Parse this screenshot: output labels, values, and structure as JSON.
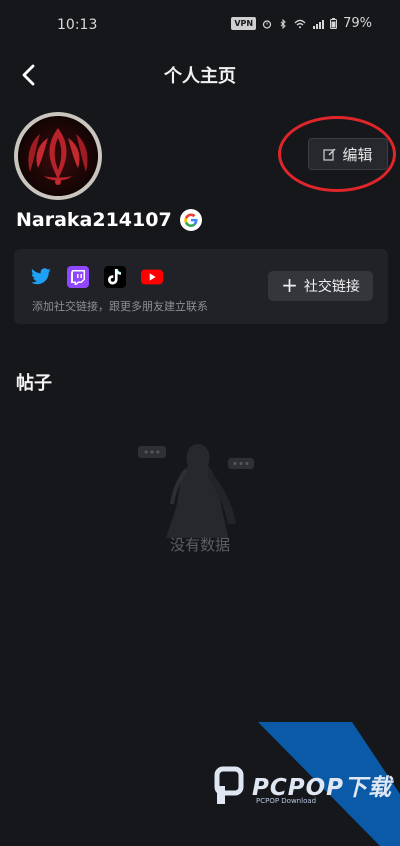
{
  "status_bar": {
    "time": "10:13",
    "vpn": "VPN",
    "battery": "79%"
  },
  "header": {
    "title": "个人主页",
    "back_icon": "chevron-left-icon"
  },
  "profile": {
    "username": "Naraka214107",
    "edit_label": "编辑",
    "account_badge": "google-icon"
  },
  "social": {
    "platforms": [
      "twitter",
      "twitch",
      "tiktok",
      "youtube"
    ],
    "hint": "添加社交链接，跟更多朋友建立联系",
    "link_button": "社交链接"
  },
  "posts": {
    "title": "帖子",
    "empty_text": "没有数据"
  },
  "watermark": {
    "text": "PCPOP下载",
    "sub": "PCPOP Download"
  },
  "colors": {
    "background": "#16171b",
    "card": "#202227",
    "annotation": "#e0262a",
    "watermark_blue": "#0a5aa8"
  }
}
